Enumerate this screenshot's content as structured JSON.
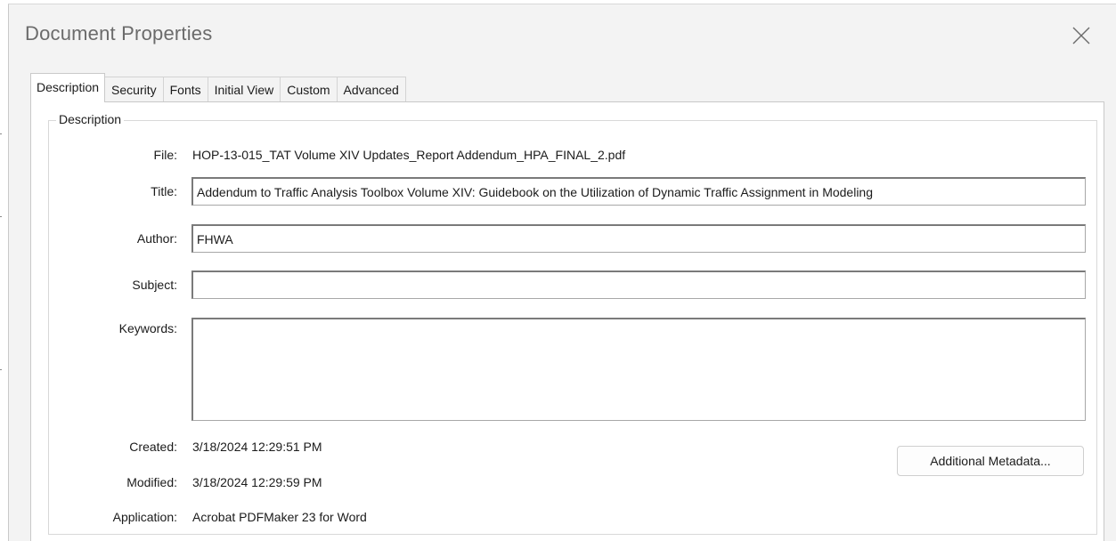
{
  "dialog": {
    "title": "Document Properties",
    "close_glyph": "close-icon"
  },
  "tabs": [
    {
      "label": "Description",
      "active": true
    },
    {
      "label": "Security",
      "active": false
    },
    {
      "label": "Fonts",
      "active": false
    },
    {
      "label": "Initial View",
      "active": false
    },
    {
      "label": "Custom",
      "active": false
    },
    {
      "label": "Advanced",
      "active": false
    }
  ],
  "description": {
    "group_label": "Description",
    "file_label": "File:",
    "file_value": "HOP-13-015_TAT Volume XIV Updates_Report Addendum_HPA_FINAL_2.pdf",
    "title_label": "Title:",
    "title_value": "Addendum to Traffic Analysis Toolbox Volume XIV: Guidebook on the Utilization of Dynamic Traffic Assignment in Modeling",
    "author_label": "Author:",
    "author_value": "FHWA",
    "subject_label": "Subject:",
    "subject_value": "",
    "keywords_label": "Keywords:",
    "keywords_value": "",
    "created_label": "Created:",
    "created_value": "3/18/2024 12:29:51 PM",
    "modified_label": "Modified:",
    "modified_value": "3/18/2024 12:29:59 PM",
    "application_label": "Application:",
    "application_value": "Acrobat PDFMaker 23 for Word",
    "metadata_button": "Additional Metadata..."
  }
}
